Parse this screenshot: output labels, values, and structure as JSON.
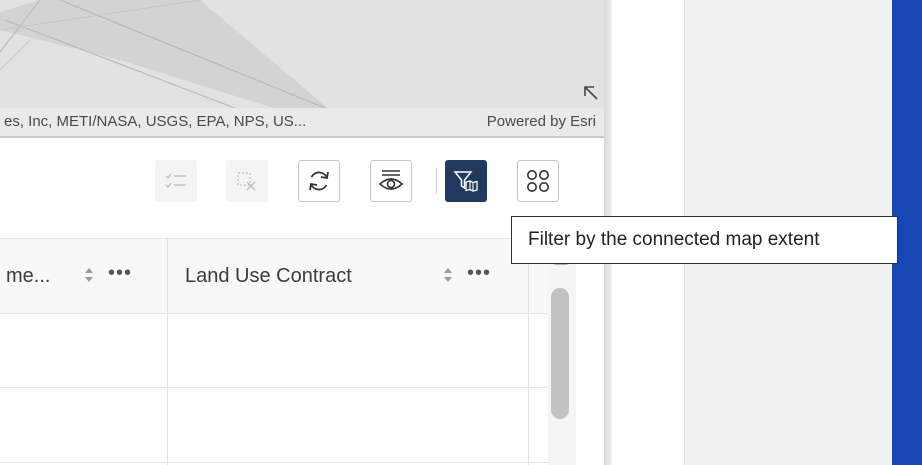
{
  "map": {
    "attribution_text": "es, Inc, METI/NASA, USGS, EPA, NPS, US...",
    "powered_by": "Powered by Esri",
    "expand_icon": "expand-arrow-icon"
  },
  "toolbar": {
    "buttons": [
      {
        "name": "show-selection",
        "icon": "checklist-icon",
        "state": "disabled"
      },
      {
        "name": "clear-selection",
        "icon": "select-clear-icon",
        "state": "disabled"
      },
      {
        "name": "refresh",
        "icon": "refresh-icon",
        "state": "enabled"
      },
      {
        "name": "show-hide-columns",
        "icon": "eye-columns-icon",
        "state": "enabled"
      },
      {
        "name": "filter-by-map-extent",
        "icon": "filter-map-icon",
        "state": "active"
      },
      {
        "name": "more-options",
        "icon": "grid-circles-icon",
        "state": "enabled"
      }
    ]
  },
  "tooltip": {
    "text": "Filter by the connected map extent"
  },
  "table": {
    "columns": [
      {
        "label": "me...",
        "sort_icon": "sort-icon",
        "menu_icon": "more-horizontal-icon"
      },
      {
        "label": "Land Use Contract",
        "sort_icon": "sort-icon",
        "menu_icon": "more-horizontal-icon"
      }
    ],
    "more_label": "•••",
    "rows": [
      [
        "",
        ""
      ],
      [
        "",
        ""
      ]
    ]
  },
  "colors": {
    "active_button": "#1f3a5e",
    "right_strip": "#1747b7",
    "map_background": "#e2e2e2"
  }
}
